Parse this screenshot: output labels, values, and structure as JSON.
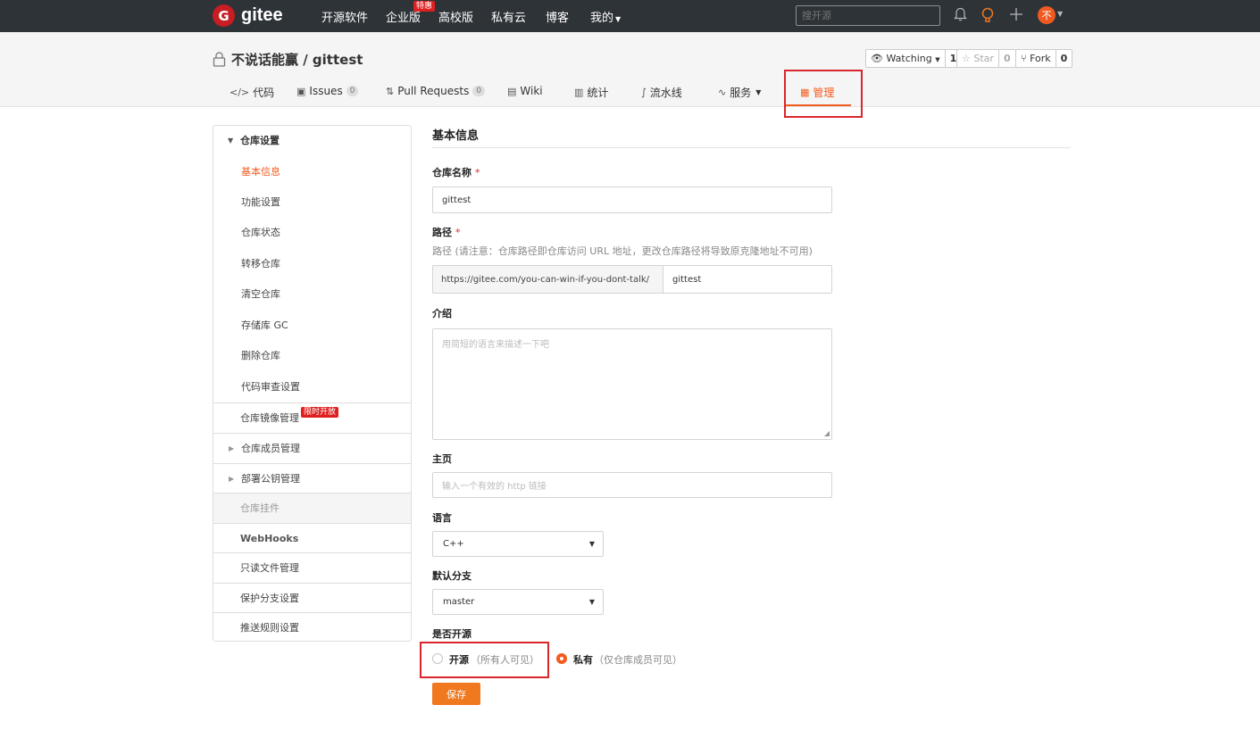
{
  "topnav": {
    "logo_mark": "G",
    "logo_text": "gitee",
    "links": [
      "开源软件",
      "企业版",
      "高校版",
      "私有云",
      "博客",
      "我的"
    ],
    "hot_badge": "特惠",
    "search_placeholder": "搜开源",
    "avatar_text": "不"
  },
  "repo": {
    "title": "不说话能赢 / gittest",
    "watching_label": "Watching",
    "watching_count": "1",
    "star_label": "Star",
    "star_count": "0",
    "fork_label": "Fork",
    "fork_count": "0",
    "tabs": [
      {
        "label": "代码",
        "icon": "code-icon"
      },
      {
        "label": "Issues",
        "count": "0",
        "icon": "issues-icon"
      },
      {
        "label": "Pull Requests",
        "count": "0",
        "icon": "pull-request-icon"
      },
      {
        "label": "Wiki",
        "icon": "wiki-icon"
      },
      {
        "label": "统计",
        "icon": "chart-icon"
      },
      {
        "label": "流水线",
        "icon": "pipeline-icon"
      },
      {
        "label": "服务",
        "icon": "pulse-icon"
      },
      {
        "label": "管理",
        "icon": "admin-icon",
        "active": true
      }
    ]
  },
  "sidebar": {
    "group_title": "仓库设置",
    "sub_items": [
      "基本信息",
      "功能设置",
      "仓库状态",
      "转移仓库",
      "清空仓库",
      "存储库 GC",
      "删除仓库",
      "代码审查设置"
    ],
    "mirror": "仓库镜像管理",
    "mirror_badge": "限时开放",
    "members": "仓库成员管理",
    "deploy_keys": "部署公钥管理",
    "plugins": "仓库挂件",
    "webhooks": "WebHooks",
    "readonly": "只读文件管理",
    "protected": "保护分支设置",
    "push_rules": "推送规则设置"
  },
  "form": {
    "section_title": "基本信息",
    "name_label": "仓库名称",
    "required_mark": "*",
    "name_value": "gittest",
    "path_label": "路径",
    "path_hint": "路径 (请注意：仓库路径即仓库访问 URL 地址，更改仓库路径将导致原克隆地址不可用)",
    "path_prefix": "https://gitee.com/you-can-win-if-you-dont-talk/",
    "path_value": "gittest",
    "intro_label": "介绍",
    "intro_placeholder": "用简短的语言来描述一下吧",
    "homepage_label": "主页",
    "homepage_placeholder": "输入一个有效的 http 链接",
    "language_label": "语言",
    "language_value": "C++",
    "branch_label": "默认分支",
    "branch_value": "master",
    "open_label": "是否开源",
    "public_label": "开源",
    "public_note": "（所有人可见）",
    "private_label": "私有",
    "private_note": "（仅仓库成员可见）",
    "visibility_selected": "私有",
    "save_label": "保存"
  },
  "colors": {
    "accent": "#f35b1f",
    "nav_bg": "#2e3338",
    "highlight_box": "#d9262c"
  }
}
